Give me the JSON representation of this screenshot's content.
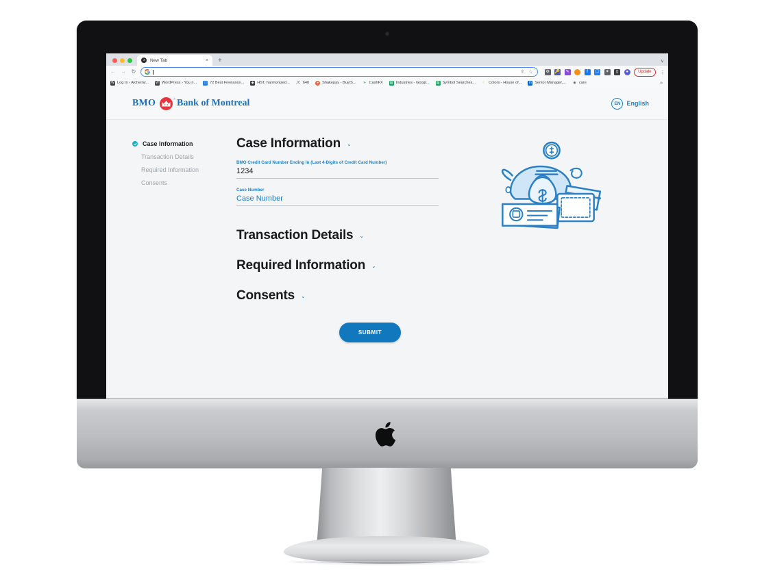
{
  "browser": {
    "tab": {
      "title": "New Tab",
      "favicon": "chrome-favicon",
      "close_label": "×"
    },
    "new_tab_label": "+",
    "tabstrip_menu": "∨",
    "nav": {
      "back": "←",
      "forward": "→",
      "reload": "↻"
    },
    "omnibox": {
      "value": "",
      "placeholder": "",
      "search_engine_icon": "google-g-icon"
    },
    "omnibox_actions": [
      "share-icon",
      "bookmark-star-icon"
    ],
    "extensions": [
      "extensions-puzzle-icon",
      "password-key-icon",
      "pen-icon",
      "orange-dot-icon",
      "facebook-icon",
      "crop-icon",
      "puzzle-icon",
      "sidebar-icon",
      "profile-avatar-icon"
    ],
    "update_label": "Update",
    "menu_label": "⋮",
    "bookmarks": [
      {
        "label": "Log In ‹ Alchemy...",
        "icon": "wordpress-icon",
        "color": "#464646"
      },
      {
        "label": "WordPress › You n...",
        "icon": "wordpress-icon",
        "color": "#464646"
      },
      {
        "label": "72 Best Freelance...",
        "icon": "page-icon",
        "color": "#2a7ede"
      },
      {
        "label": "HST, harmonized...",
        "icon": "canada-icon",
        "color": "#3a3a3a"
      },
      {
        "label": "640",
        "icon": "jc-icon",
        "color": "#6b6b6b"
      },
      {
        "label": "Shakepay - Buy/S...",
        "icon": "shakepay-icon",
        "color": "#e0643c"
      },
      {
        "label": "CashFX",
        "icon": "cashfx-icon",
        "color": "#3fbf57"
      },
      {
        "label": "Industries - Googl...",
        "icon": "sheets-icon",
        "color": "#1aa463"
      },
      {
        "label": "Symbol Searches...",
        "icon": "sheets-icon",
        "color": "#1aa463"
      },
      {
        "label": "Colors - House of...",
        "icon": "moon-icon",
        "color": "#e8b020"
      },
      {
        "label": "Senior Manager,...",
        "icon": "linkedin-icon",
        "color": "#0a66c2"
      },
      {
        "label": "care",
        "icon": "globe-icon",
        "color": "#5f6368"
      }
    ],
    "bookmarks_overflow": "»"
  },
  "site": {
    "brand": {
      "bmo": "BMO",
      "name": "Bank of Montreal",
      "trademark": "®"
    },
    "language": {
      "code": "EN",
      "label": "English"
    }
  },
  "sidebar": {
    "items": [
      {
        "label": "Case Information",
        "active": true,
        "icon": "check-circle-icon"
      },
      {
        "label": "Transaction Details",
        "active": false
      },
      {
        "label": "Required Information",
        "active": false
      },
      {
        "label": "Consents",
        "active": false
      }
    ]
  },
  "form": {
    "sections": [
      {
        "title": "Case Information",
        "caret": "⌄",
        "expanded": true
      },
      {
        "title": "Transaction Details",
        "caret": "⌄",
        "expanded": false
      },
      {
        "title": "Required Information",
        "caret": "⌄",
        "expanded": false
      },
      {
        "title": "Consents",
        "caret": "⌄",
        "expanded": false
      }
    ],
    "fields": [
      {
        "label": "BMO Credit Card Number Ending In (Last 4-Digits of Credit Card Number)",
        "value": "1234",
        "placeholder": ""
      },
      {
        "label": "Case Number",
        "value": "",
        "placeholder": "Case Number"
      }
    ],
    "submit_label": "SUBMIT"
  },
  "illustration": {
    "name": "piggy-bank-savings-illustration"
  },
  "colors": {
    "accent_blue": "#1c7ec4",
    "brand_blue": "#1c6fba",
    "bmo_red": "#e7343f",
    "submit_blue": "#1278be",
    "check_teal": "#19b3c9",
    "page_bg": "#f4f5f6"
  }
}
